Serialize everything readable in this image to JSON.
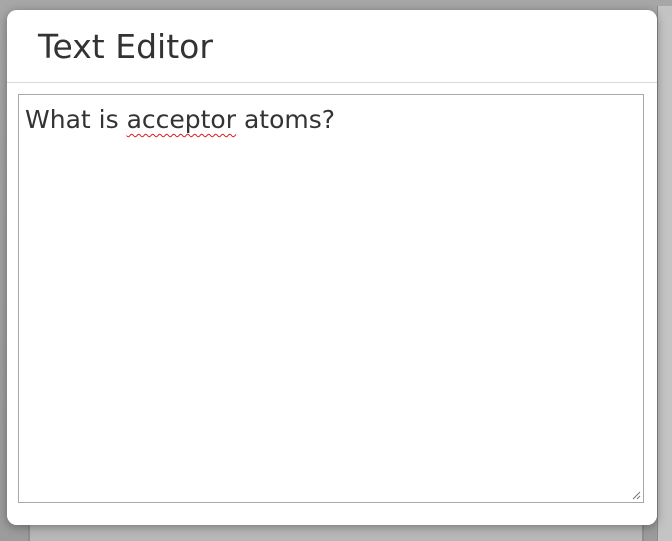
{
  "dialog": {
    "title": "Text Editor"
  },
  "editor": {
    "text_before": "What is ",
    "misspelled_word": "acceptor",
    "text_after": " atoms?"
  },
  "colors": {
    "spellcheck_underline": "#d81b1b",
    "text": "#333333",
    "border": "#a8a8a8"
  },
  "icons": {
    "resize": "resize-handle-icon"
  }
}
